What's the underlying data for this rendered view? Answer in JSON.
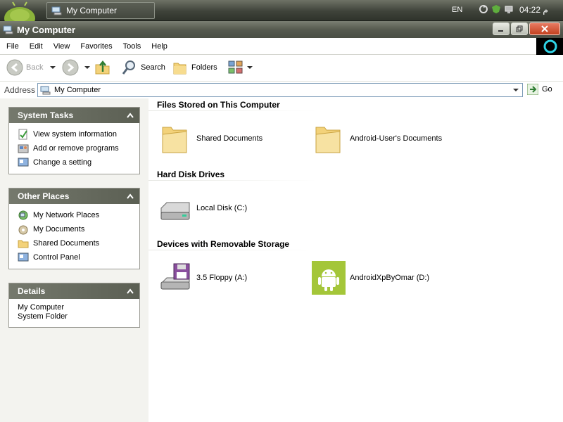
{
  "taskbar": {
    "task_button": "My Computer",
    "language": "EN",
    "clock": "04:22 م"
  },
  "window": {
    "title": "My Computer",
    "controls": [
      "minimize",
      "maximize",
      "close"
    ]
  },
  "menu": [
    "File",
    "Edit",
    "View",
    "Favorites",
    "Tools",
    "Help"
  ],
  "toolbar": {
    "back": "Back",
    "search": "Search",
    "folders": "Folders"
  },
  "address": {
    "label": "Address",
    "value": "My Computer",
    "go": "Go"
  },
  "sidebar": {
    "system_tasks": {
      "title": "System Tasks",
      "items": [
        "View system information",
        "Add or remove programs",
        "Change a setting"
      ]
    },
    "other_places": {
      "title": "Other Places",
      "items": [
        "My Network Places",
        "My Documents",
        "Shared Documents",
        "Control Panel"
      ]
    },
    "details": {
      "title": "Details",
      "name": "My Computer",
      "type": "System Folder"
    }
  },
  "content": {
    "groups": [
      {
        "title": "Files Stored on This Computer",
        "items": [
          "Shared Documents",
          "Android-User's Documents"
        ]
      },
      {
        "title": "Hard Disk Drives",
        "items": [
          "Local Disk (C:)"
        ]
      },
      {
        "title": "Devices with Removable Storage",
        "items": [
          "3.5 Floppy (A:)",
          "AndroidXpByOmar (D:)"
        ]
      }
    ]
  },
  "colors": {
    "chrome_dark": "#4a4e44",
    "panel_header": "#5b5f53",
    "folder_yellow": "#f3d27a",
    "android_green": "#a4c639"
  }
}
